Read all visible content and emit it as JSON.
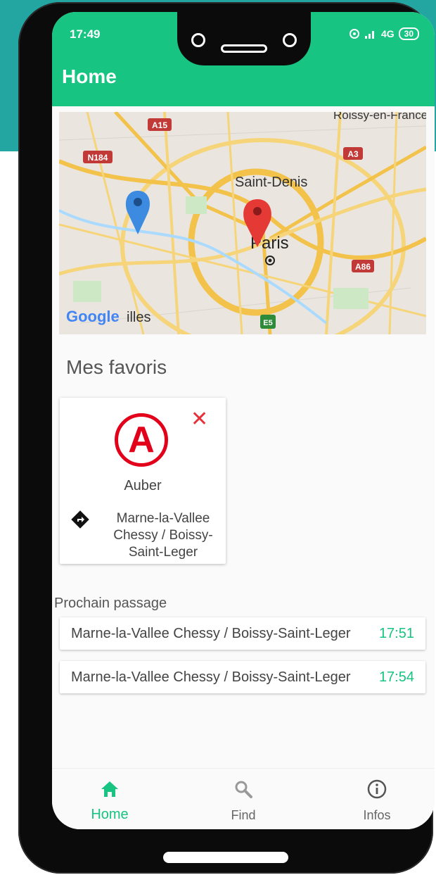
{
  "status": {
    "time": "17:49",
    "network": "4G",
    "battery": "30"
  },
  "appbar": {
    "title": "Home"
  },
  "map": {
    "labels": {
      "roissy": "Roissy-en-France",
      "a15": "A15",
      "n184": "N184",
      "a3": "A3",
      "saint_denis": "Saint-Denis",
      "paris": "Paris",
      "a86": "A86",
      "e5": "E5",
      "google": "Google",
      "villes": "illes"
    },
    "markers": [
      "blue-marker",
      "red-marker"
    ]
  },
  "favorites": {
    "title": "Mes favoris",
    "items": [
      {
        "line": "A",
        "station": "Auber",
        "direction": "Marne-la-Vallee Chessy / Boissy-Saint-Leger",
        "close": "✕",
        "line_color": "#e2001a"
      }
    ]
  },
  "next": {
    "label": "Prochain passage",
    "rows": [
      {
        "direction": "Marne-la-Vallee Chessy / Boissy-Saint-Leger",
        "time": "17:51"
      },
      {
        "direction": "Marne-la-Vallee Chessy / Boissy-Saint-Leger",
        "time": "17:54"
      }
    ]
  },
  "nav": {
    "items": [
      {
        "label": "Home",
        "icon": "home-icon",
        "active": true
      },
      {
        "label": "Find",
        "icon": "search-icon",
        "active": false
      },
      {
        "label": "Infos",
        "icon": "info-icon",
        "active": false
      }
    ]
  },
  "colors": {
    "accent": "#17c481",
    "line_a": "#e2001a",
    "backdrop": "#23a6a1"
  }
}
